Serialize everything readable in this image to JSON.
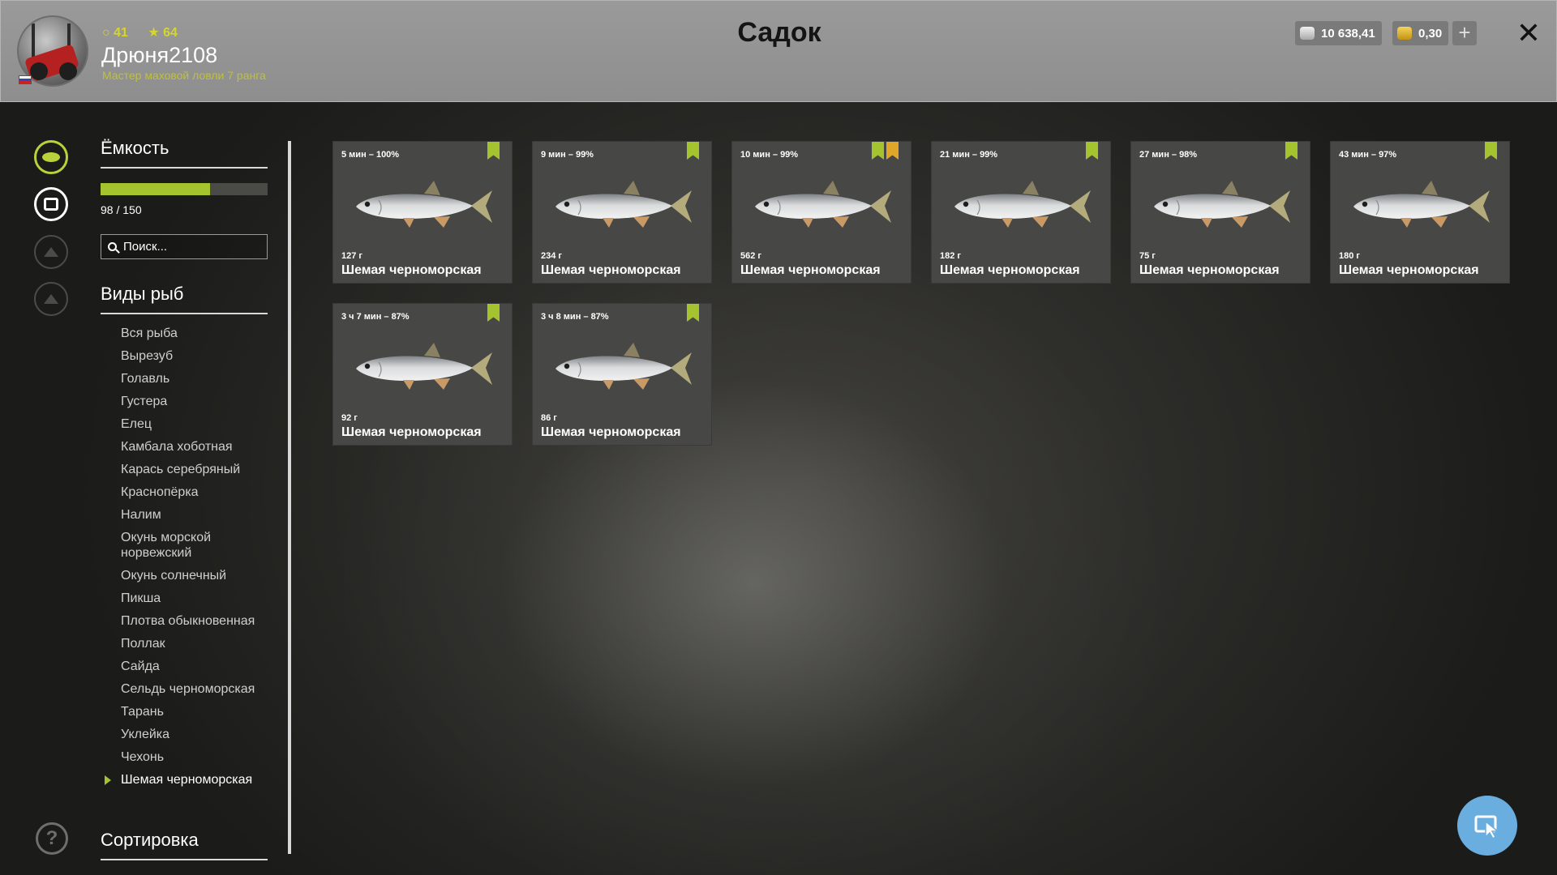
{
  "header": {
    "title": "Садок",
    "username": "Дрюня2108",
    "rank": "Мастер маховой ловли 7 ранга",
    "level": "41",
    "stars": "64",
    "silver": "10 638,41",
    "gold": "0,30"
  },
  "panel": {
    "capacity_title": "Ёмкость",
    "capacity_text": "98 / 150",
    "capacity_fraction": 0.653,
    "search_placeholder": "Поиск...",
    "species_title": "Виды рыб",
    "species": [
      "Вся рыба",
      "Вырезуб",
      "Голавль",
      "Густера",
      "Елец",
      "Камбала хоботная",
      "Карась серебряный",
      "Краснопёрка",
      "Налим",
      "Окунь морской норвежский",
      "Окунь солнечный",
      "Пикша",
      "Плотва обыкновенная",
      "Поллак",
      "Сайда",
      "Сельдь черноморская",
      "Тарань",
      "Уклейка",
      "Чехонь",
      "Шемая черноморская"
    ],
    "sort_title": "Сортировка"
  },
  "fish": [
    {
      "time": "5 мин – 100%",
      "weight": "127 г",
      "name": "Шемая черноморская"
    },
    {
      "time": "9 мин – 99%",
      "weight": "234 г",
      "name": "Шемая черноморская"
    },
    {
      "time": "10 мин – 99%",
      "weight": "562 г",
      "name": "Шемая черноморская"
    },
    {
      "time": "21 мин – 99%",
      "weight": "182 г",
      "name": "Шемая черноморская"
    },
    {
      "time": "27 мин – 98%",
      "weight": "75 г",
      "name": "Шемая черноморская"
    },
    {
      "time": "43 мин – 97%",
      "weight": "180 г",
      "name": "Шемая черноморская"
    },
    {
      "time": "3 ч 7 мин – 87%",
      "weight": "92 г",
      "name": "Шемая черноморская"
    },
    {
      "time": "3 ч 8 мин – 87%",
      "weight": "86 г",
      "name": "Шемая черноморская"
    }
  ],
  "colors": {
    "accent": "#a5c22f",
    "gold_marker": "#e0a629",
    "header_bg": "#969696",
    "card_bg": "#474745"
  },
  "icons": [
    "fish-icon",
    "keepnet-icon",
    "upgrade-icon",
    "home-icon",
    "help-icon",
    "bookmark-icon",
    "star-bookmark-icon",
    "cursor-icon",
    "close-icon",
    "plus-icon",
    "search-icon"
  ]
}
